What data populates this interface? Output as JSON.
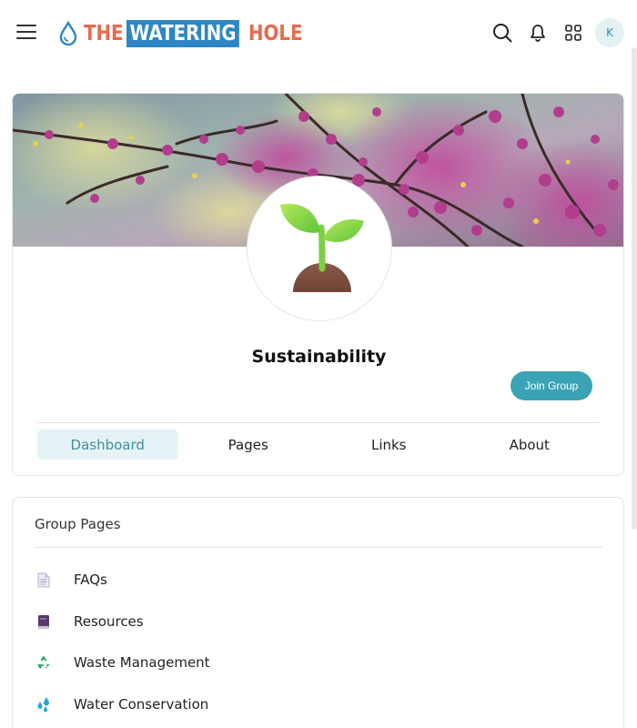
{
  "header": {
    "logo": {
      "word1": "THE",
      "word2": "WATERING",
      "word3": "HOLE"
    },
    "avatar_initial": "K",
    "icons": [
      "menu-icon",
      "search-icon",
      "bell-icon",
      "apps-grid-icon"
    ]
  },
  "group": {
    "title": "Sustainability",
    "join_label": "Join Group",
    "tabs": [
      {
        "label": "Dashboard",
        "active": true
      },
      {
        "label": "Pages",
        "active": false
      },
      {
        "label": "Links",
        "active": false
      },
      {
        "label": "About",
        "active": false
      }
    ]
  },
  "group_pages": {
    "heading": "Group Pages",
    "items": [
      {
        "label": "FAQs",
        "icon": "document-icon"
      },
      {
        "label": "Resources",
        "icon": "book-icon"
      },
      {
        "label": "Waste Management",
        "icon": "recycle-icon"
      },
      {
        "label": "Water Conservation",
        "icon": "water-droplets-icon"
      }
    ]
  },
  "colors": {
    "brand_orange": "#e76a4e",
    "brand_blue": "#2d87c4",
    "accent_teal": "#3aa3b6",
    "tab_active_bg": "#e6f3f6"
  }
}
